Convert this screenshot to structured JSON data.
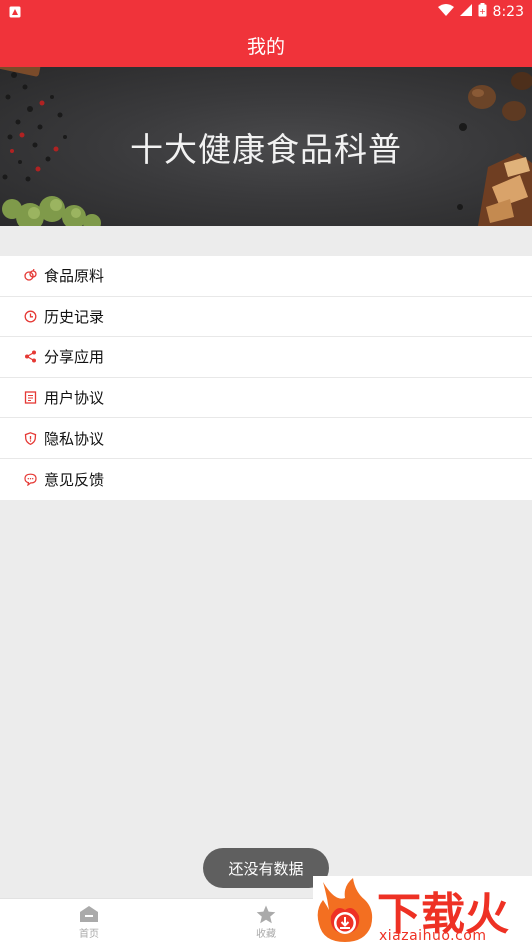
{
  "status_bar": {
    "time": "8:23",
    "icons": [
      "notification-icon",
      "wifi-icon",
      "signal-icon",
      "battery-icon"
    ]
  },
  "header": {
    "title": "我的"
  },
  "banner": {
    "title": "十大健康食品科普"
  },
  "menu": {
    "items": [
      {
        "label": "食品原料",
        "icon": "ingredients-icon"
      },
      {
        "label": "历史记录",
        "icon": "clock-icon"
      },
      {
        "label": "分享应用",
        "icon": "share-icon"
      },
      {
        "label": "用户协议",
        "icon": "document-icon"
      },
      {
        "label": "隐私协议",
        "icon": "shield-icon"
      },
      {
        "label": "意见反馈",
        "icon": "chat-bubble-icon"
      }
    ]
  },
  "toast": {
    "text": "还没有数据"
  },
  "bottom_nav": {
    "tabs": [
      {
        "label": "首页",
        "icon": "home-icon"
      },
      {
        "label": "收藏",
        "icon": "star-icon"
      }
    ]
  },
  "watermark": {
    "title": "下载火",
    "subtitle": "xiazaihuo.com"
  },
  "colors": {
    "primary": "#f0333a",
    "accent_icon": "#e53935",
    "background": "#ececec"
  }
}
